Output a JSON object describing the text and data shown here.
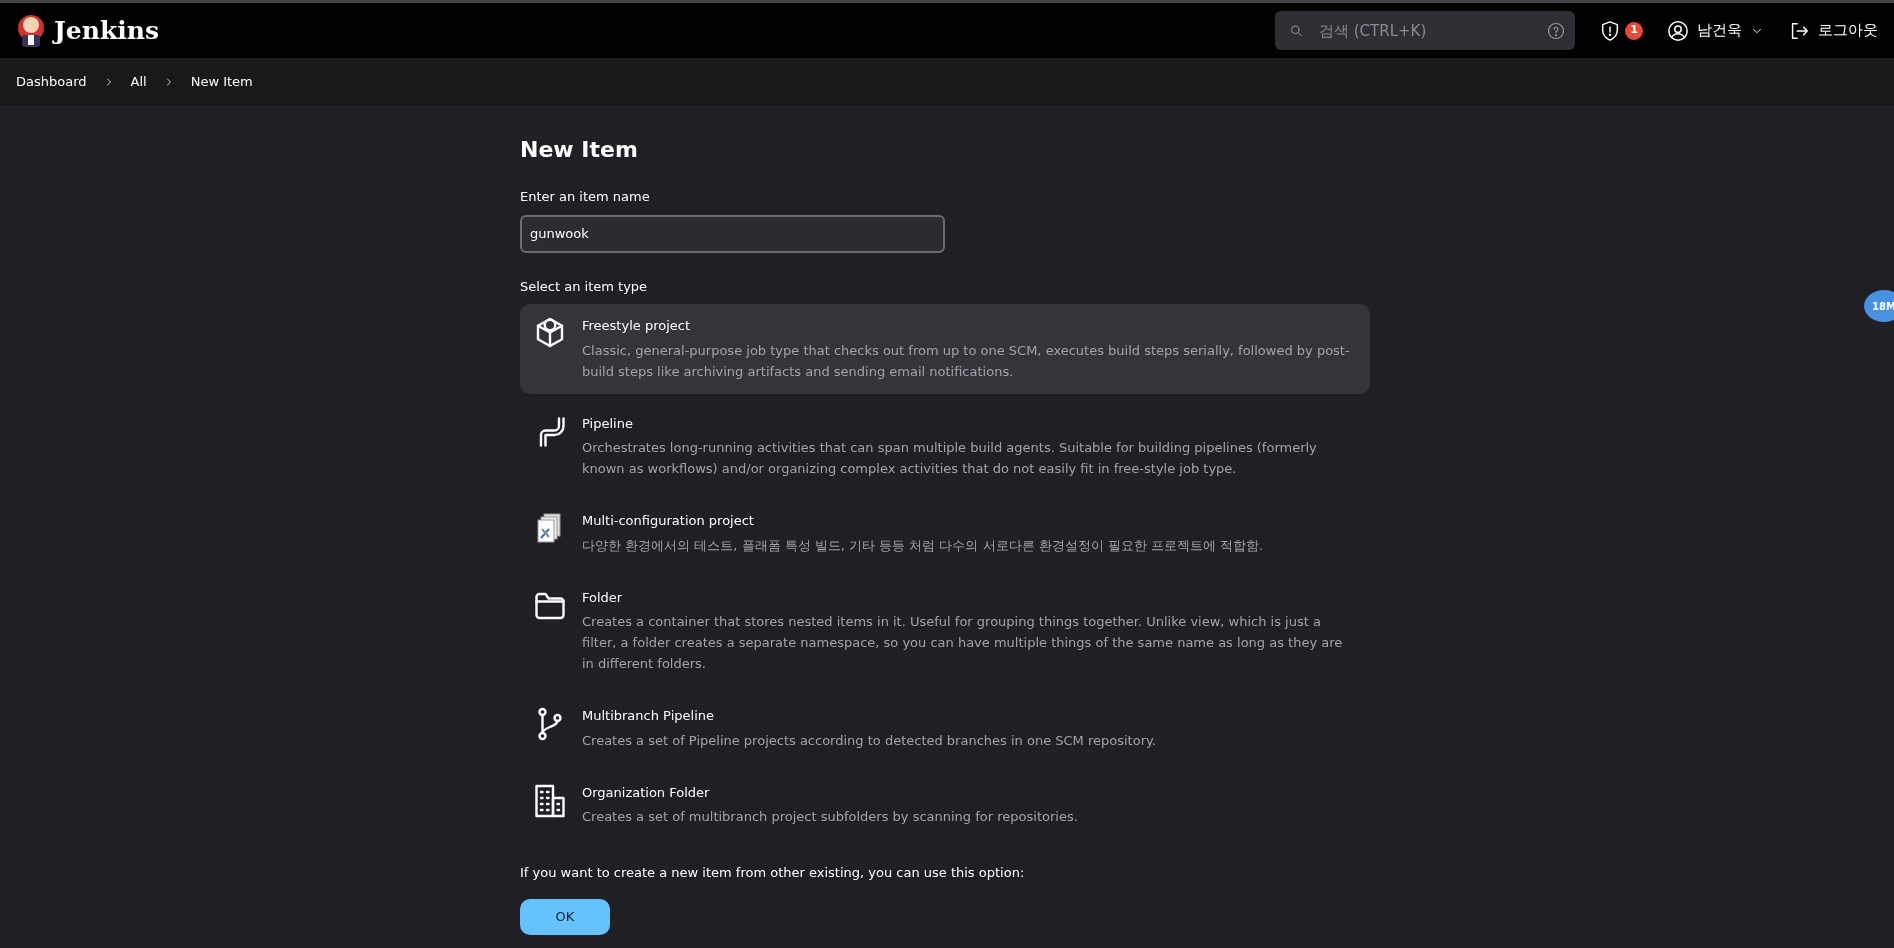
{
  "header": {
    "logo_text": "Jenkins",
    "search": {
      "placeholder": "검색 (CTRL+K)"
    },
    "alerts_badge": "1",
    "user": "남건욱",
    "logout": "로그아웃"
  },
  "breadcrumbs": [
    "Dashboard",
    "All",
    "New Item"
  ],
  "page_title": "New Item",
  "name_field": {
    "label": "Enter an item name",
    "value": "gunwook"
  },
  "types_label": "Select an item type",
  "item_types": [
    {
      "name": "Freestyle project",
      "description": "Classic, general-purpose job type that checks out from up to one SCM, executes build steps serially, followed by post-build steps like archiving artifacts and sending email notifications.",
      "selected": true
    },
    {
      "name": "Pipeline",
      "description": "Orchestrates long-running activities that can span multiple build agents. Suitable for building pipelines (formerly known as workflows) and/or organizing complex activities that do not easily fit in free-style job type.",
      "selected": false
    },
    {
      "name": "Multi-configuration project",
      "description": "다양한 환경에서의 테스트, 플래폼 특성 빌드, 기타 등등 처럼 다수의 서로다른 환경설정이 필요한 프로젝트에 적합함.",
      "selected": false
    },
    {
      "name": "Folder",
      "description": "Creates a container that stores nested items in it. Useful for grouping things together. Unlike view, which is just a filter, a folder creates a separate namespace, so you can have multiple things of the same name as long as they are in different folders.",
      "selected": false
    },
    {
      "name": "Multibranch Pipeline",
      "description": "Creates a set of Pipeline projects according to detected branches in one SCM repository.",
      "selected": false
    },
    {
      "name": "Organization Folder",
      "description": "Creates a set of multibranch project subfolders by scanning for repositories.",
      "selected": false
    }
  ],
  "copy_hint": "If you want to create a new item from other existing, you can use this option:",
  "ok_button": "OK",
  "memory_badge": "18M"
}
